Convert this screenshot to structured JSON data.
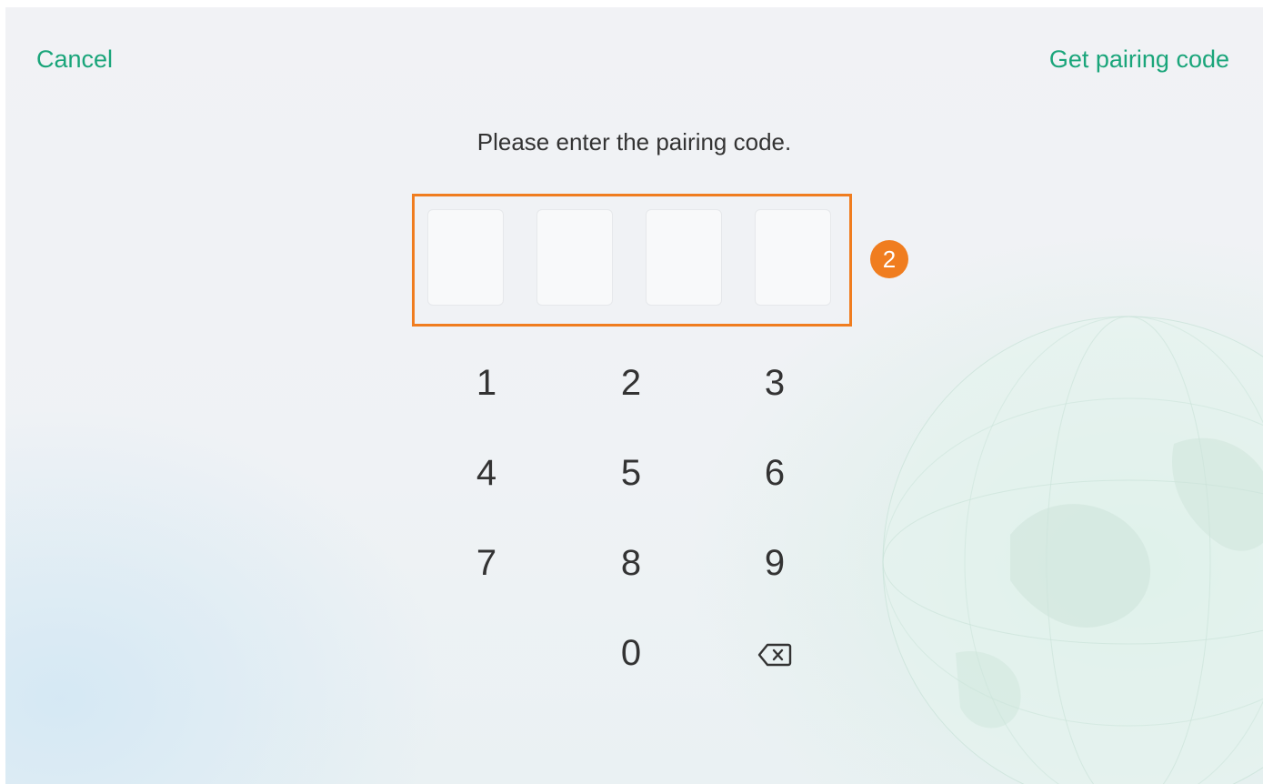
{
  "header": {
    "cancel_label": "Cancel",
    "get_code_label": "Get pairing code"
  },
  "prompt": "Please enter the pairing code.",
  "code_digits": [
    "",
    "",
    "",
    ""
  ],
  "annotation_badge": "2",
  "keypad": {
    "keys": [
      "1",
      "2",
      "3",
      "4",
      "5",
      "6",
      "7",
      "8",
      "9",
      "0"
    ],
    "backspace_icon": "backspace-icon"
  },
  "colors": {
    "accent": "#1aa57a",
    "highlight": "#f07d1f",
    "text": "#333333"
  }
}
